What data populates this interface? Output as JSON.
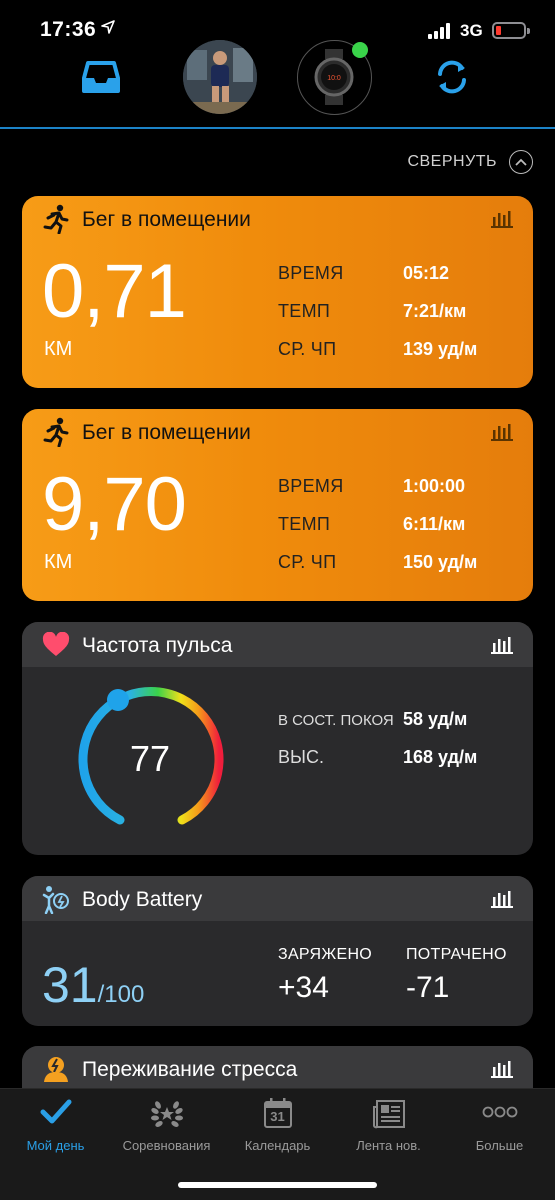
{
  "status_bar": {
    "time": "17:36",
    "network": "3G"
  },
  "header": {
    "icons": [
      "inbox-icon",
      "avatar",
      "watch-icon",
      "sync-icon"
    ],
    "accent_color": "#1c83c7"
  },
  "collapse": {
    "label": "СВЕРНУТЬ"
  },
  "activities": [
    {
      "title": "Бег в помещении",
      "distance": "0,71",
      "unit": "КМ",
      "stats": [
        {
          "label": "ВРЕМЯ",
          "value": "05:12"
        },
        {
          "label": "ТЕМП",
          "value": "7:21/км"
        },
        {
          "label": "СР. ЧП",
          "value": "139 уд/м"
        }
      ]
    },
    {
      "title": "Бег в помещении",
      "distance": "9,70",
      "unit": "КМ",
      "stats": [
        {
          "label": "ВРЕМЯ",
          "value": "1:00:00"
        },
        {
          "label": "ТЕМП",
          "value": "6:11/км"
        },
        {
          "label": "СР. ЧП",
          "value": "150 уд/м"
        }
      ]
    }
  ],
  "heart_rate": {
    "title": "Частота пульса",
    "current": "77",
    "resting_label": "В СОСТ. ПОКОЯ",
    "resting_value": "58 уд/м",
    "max_label": "ВЫС.",
    "max_value": "168 уд/м"
  },
  "body_battery": {
    "title": "Body Battery",
    "value": "31",
    "max": "/100",
    "charged_label": "ЗАРЯЖЕНО",
    "charged_value": "+34",
    "drained_label": "ПОТРАЧЕНО",
    "drained_value": "-71"
  },
  "stress": {
    "title": "Переживание стресса"
  },
  "tabs": [
    {
      "label": "Мой день",
      "icon": "check-icon",
      "active": true
    },
    {
      "label": "Соревнования",
      "icon": "laurel-icon",
      "active": false
    },
    {
      "label": "Календарь",
      "icon": "calendar-icon",
      "active": false,
      "calendar_day": "31"
    },
    {
      "label": "Лента нов.",
      "icon": "news-icon",
      "active": false
    },
    {
      "label": "Больше",
      "icon": "more-icon",
      "active": false
    }
  ]
}
